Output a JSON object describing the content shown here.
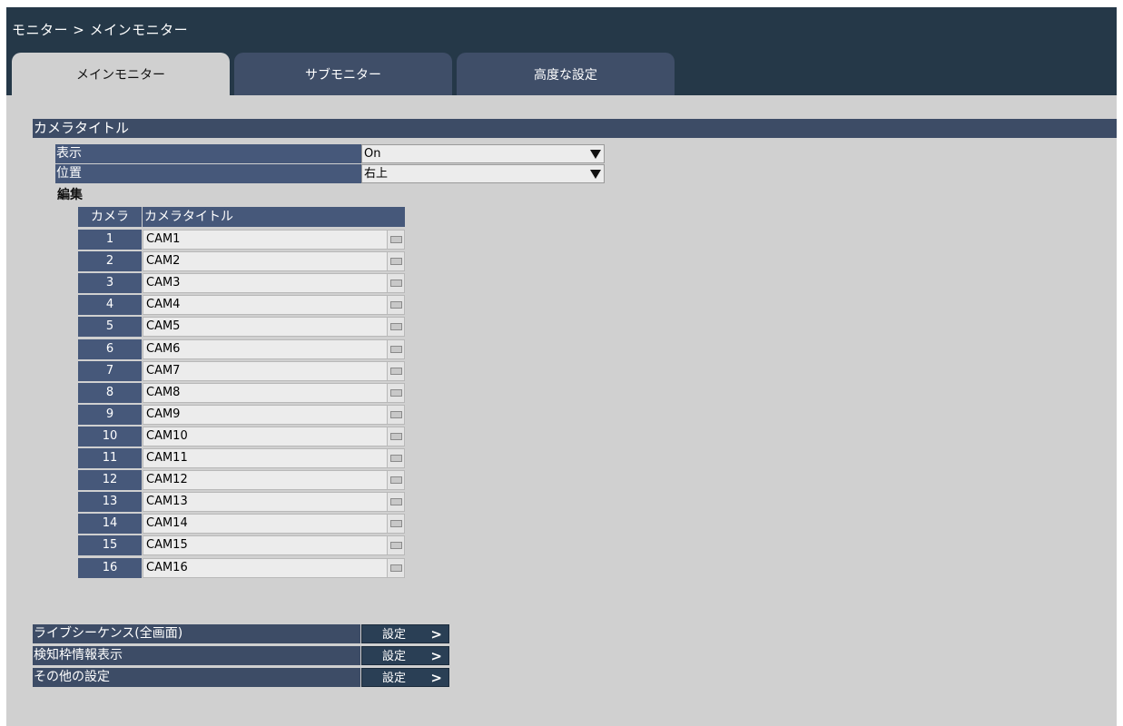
{
  "breadcrumb": "モニター > メインモニター",
  "tabs": [
    {
      "label": "メインモニター"
    },
    {
      "label": "サブモニター"
    },
    {
      "label": "高度な設定"
    }
  ],
  "camera_title": {
    "header": "カメラタイトル",
    "display_label": "表示",
    "display_value": "On",
    "position_label": "位置",
    "position_value": "右上",
    "edit_label": "編集",
    "table_headers": {
      "camera": "カメラ",
      "title": "カメラタイトル"
    },
    "rows": [
      {
        "num": "1",
        "title": "CAM1"
      },
      {
        "num": "2",
        "title": "CAM2"
      },
      {
        "num": "3",
        "title": "CAM3"
      },
      {
        "num": "4",
        "title": "CAM4"
      },
      {
        "num": "5",
        "title": "CAM5"
      },
      {
        "num": "6",
        "title": "CAM6"
      },
      {
        "num": "7",
        "title": "CAM7"
      },
      {
        "num": "8",
        "title": "CAM8"
      },
      {
        "num": "9",
        "title": "CAM9"
      },
      {
        "num": "10",
        "title": "CAM10"
      },
      {
        "num": "11",
        "title": "CAM11"
      },
      {
        "num": "12",
        "title": "CAM12"
      },
      {
        "num": "13",
        "title": "CAM13"
      },
      {
        "num": "14",
        "title": "CAM14"
      },
      {
        "num": "15",
        "title": "CAM15"
      },
      {
        "num": "16",
        "title": "CAM16"
      }
    ]
  },
  "links": [
    {
      "label": "ライブシーケンス(全画面)",
      "button": "設定"
    },
    {
      "label": "検知枠情報表示",
      "button": "設定"
    },
    {
      "label": "その他の設定",
      "button": "設定"
    }
  ],
  "icons": {
    "dropdown": "chevron-down-icon",
    "keyboard": "keyboard-icon",
    "arrow": "chevron-right-icon"
  }
}
